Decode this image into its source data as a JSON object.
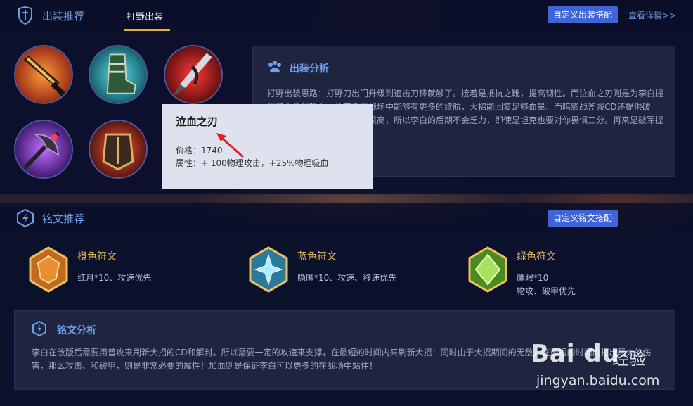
{
  "build_section": {
    "title": "出装推荐",
    "tab": "打野出装",
    "custom_button": "自定义出装搭配",
    "details_link": "查看详情>>",
    "items": [
      {
        "name": "jungle-blade"
      },
      {
        "name": "resistance-boots"
      },
      {
        "name": "bloodweeper-blade"
      },
      {
        "name": "shadow-battleaxe"
      },
      {
        "name": "armor-breaker"
      }
    ],
    "analysis": {
      "title": "出装分析",
      "text": "打野出装思路：打野刀出门升级到追击刀锋就够了。接着是抵抗之靴，提高韧性。而泣血之刃则是为李白提供了大量的吸血，让李白在战场中能够有更多的续航，大招能回复足够血量。而暗影战斧减CD还提供破甲，中期输出足够，破甲也很高，所以李白的后期不会乏力，即使是坦克也要对你畏惧三分。再来是破军提高输出，加强收割能力。"
    }
  },
  "tooltip": {
    "name": "泣血之刃",
    "price": "价格：1740",
    "attributes": "属性：+ 100物理攻击，+25%物理吸血"
  },
  "rune_section": {
    "title": "铭文推荐",
    "custom_button": "自定义铭文搭配",
    "runes": [
      {
        "name": "橙色符文",
        "desc1": "红月*10、攻速优先",
        "desc2": ""
      },
      {
        "name": "蓝色符文",
        "desc1": "隐匿*10、攻速、移速优先",
        "desc2": ""
      },
      {
        "name": "绿色符文",
        "desc1": "鹰眼*10",
        "desc2": "物攻、破甲优先"
      }
    ],
    "analysis": {
      "title": "铭文分析",
      "text": "李白在改版后需要用普攻来刷新大招的CD和解封。所以需要一定的攻速来支撑，在最短的时间内来刷新大招！同时由于大招期间的无敌，在最短的时间内打出最大的伤害，那么攻击、和破甲，则是非常必要的属性！加血则是保证李白可以更多的在战场中站住！"
    }
  },
  "watermark": {
    "brand": "Bai du",
    "text": "经验",
    "url": "jingyan.baidu.com"
  },
  "colors": {
    "accent_blue": "#6f9fe6",
    "button_blue": "#3e64d6",
    "tab_underline": "#e2b23a",
    "rune_name": "#e3b65a"
  }
}
